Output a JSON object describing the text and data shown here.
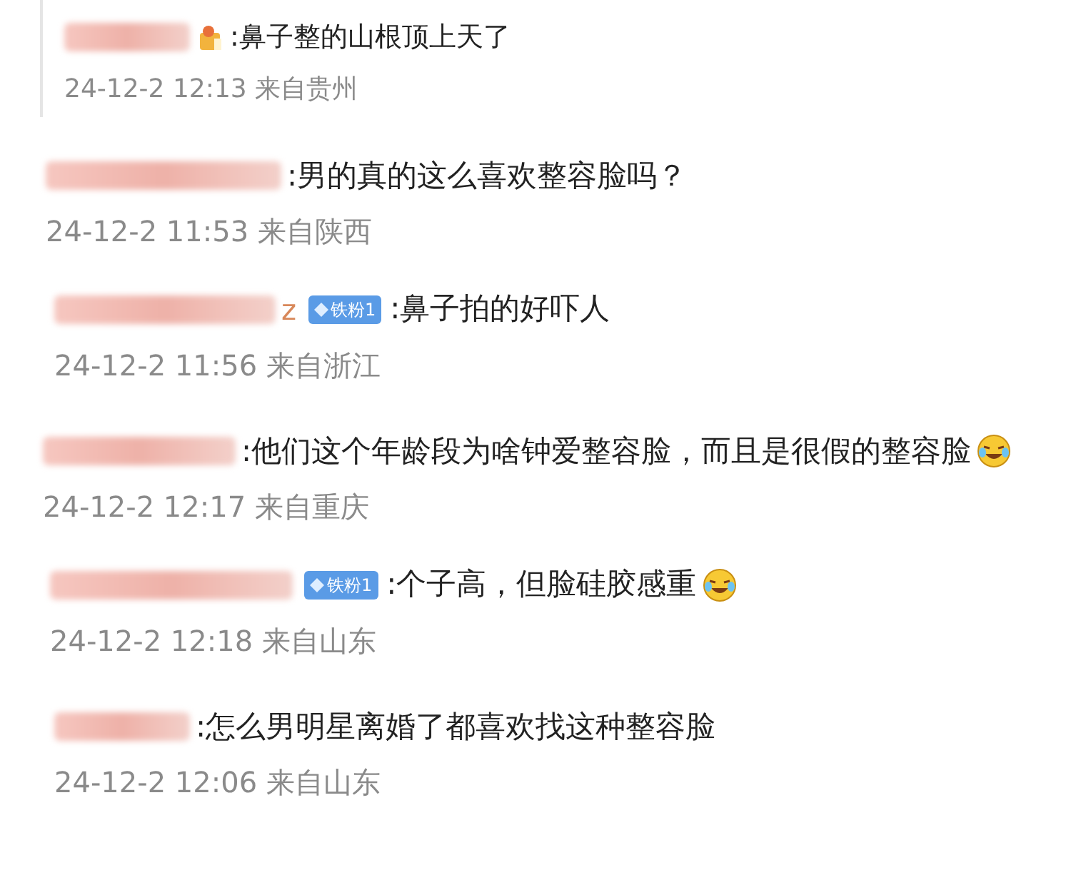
{
  "comments": [
    {
      "badge": {
        "kind": "level"
      },
      "text": ":鼻子整的山根顶上天了",
      "time": "24-12-2 12:13 来自贵州",
      "emoji": false
    },
    {
      "text": ":男的真的这么喜欢整容脸吗？",
      "time": "24-12-2 11:53 来自陕西",
      "emoji": false
    },
    {
      "name_suffix": "z",
      "badge": {
        "kind": "fan",
        "label": "铁粉1"
      },
      "text": ":鼻子拍的好吓人",
      "time": "24-12-2 11:56 来自浙江",
      "emoji": false
    },
    {
      "text": ":他们这个年龄段为啥钟爱整容脸，而且是很假的整容脸",
      "time": "24-12-2 12:17 来自重庆",
      "emoji": true
    },
    {
      "badge": {
        "kind": "fan",
        "label": "铁粉1"
      },
      "text": ":个子高，但脸硅胶感重",
      "time": "24-12-2 12:18 来自山东",
      "emoji": true
    },
    {
      "text": ":怎么男明星离婚了都喜欢找这种整容脸",
      "time": "24-12-2 12:06 来自山东",
      "emoji": false
    }
  ]
}
